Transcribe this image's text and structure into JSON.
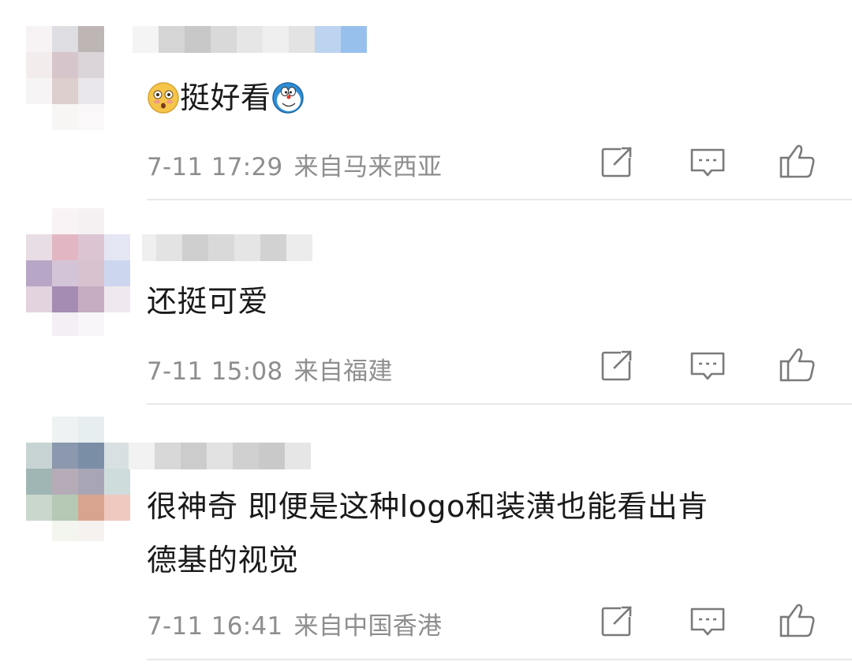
{
  "comments": [
    {
      "username_censored": true,
      "text": "挺好看",
      "leading_emoji": "flushed-face-emoji",
      "trailing_emoji": "doraemon-emoji",
      "time": "7-11 17:29",
      "location": "来自马来西亚"
    },
    {
      "username_censored": true,
      "text": "还挺可爱",
      "time": "7-11 15:08",
      "location": "来自福建"
    },
    {
      "username_censored": true,
      "text_line1": "很神奇 即便是这种logo和装潢也能看出肯",
      "text_line2": "德基的视觉",
      "time": "7-11 16:41",
      "location": "来自中国香港"
    }
  ],
  "actions": {
    "icons": [
      "share-icon",
      "reply-icon",
      "like-icon"
    ],
    "stroke_color": "#7a7a7a"
  },
  "colors": {
    "text": "#1a1a1a",
    "meta": "#8e8e8e",
    "divider": "#e8e8e8"
  }
}
